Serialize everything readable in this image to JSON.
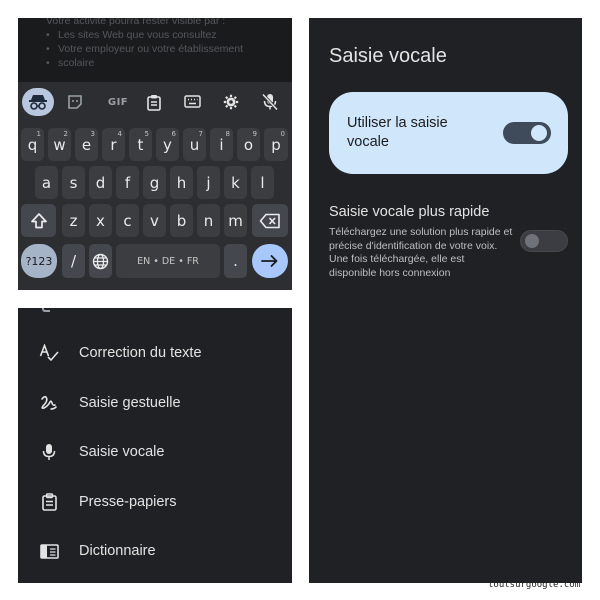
{
  "keyboard": {
    "background_text": {
      "line0": "Votre activité pourra rester visible par :",
      "bullets": [
        "Les sites Web que vous consultez",
        "Votre employeur ou votre établissement",
        "scolaire"
      ]
    },
    "toolbar": {
      "icons": [
        "incognito-icon",
        "sticker-icon",
        "gif-icon",
        "clipboard-icon",
        "keyboard-icon",
        "gear-icon",
        "mic-off-icon"
      ],
      "gif_label": "GIF"
    },
    "row1": [
      {
        "k": "q",
        "s": "1"
      },
      {
        "k": "w",
        "s": "2"
      },
      {
        "k": "e",
        "s": "3"
      },
      {
        "k": "r",
        "s": "4"
      },
      {
        "k": "t",
        "s": "5"
      },
      {
        "k": "y",
        "s": "6"
      },
      {
        "k": "u",
        "s": "7"
      },
      {
        "k": "i",
        "s": "8"
      },
      {
        "k": "o",
        "s": "9"
      },
      {
        "k": "p",
        "s": "0"
      }
    ],
    "row2": [
      "a",
      "s",
      "d",
      "f",
      "g",
      "h",
      "j",
      "k",
      "l"
    ],
    "row3": [
      "z",
      "x",
      "c",
      "v",
      "b",
      "n",
      "m"
    ],
    "sym_label": "?123",
    "slash_label": "/",
    "space_label": "EN • DE • FR",
    "period_label": ".",
    "accent_color": "#a8c7fa"
  },
  "settings_list": {
    "items": [
      {
        "icon": "text-correction-icon",
        "label": "Correction du texte"
      },
      {
        "icon": "gesture-typing-icon",
        "label": "Saisie gestuelle"
      },
      {
        "icon": "mic-icon",
        "label": "Saisie vocale"
      },
      {
        "icon": "clipboard-icon",
        "label": "Presse-papiers"
      },
      {
        "icon": "dictionary-icon",
        "label": "Dictionnaire"
      }
    ]
  },
  "voice_settings": {
    "title": "Saisie vocale",
    "main_toggle": {
      "label": "Utiliser la saisie vocale",
      "on": true
    },
    "fast_voice": {
      "title": "Saisie vocale plus rapide",
      "description": "Téléchargez une solution plus rapide et précise d'identification de votre voix. Une fois téléchargée, elle est disponible hors connexion",
      "on": false
    },
    "card_color": "#cfe6fb"
  },
  "watermark": "toutsurgoogle.com"
}
